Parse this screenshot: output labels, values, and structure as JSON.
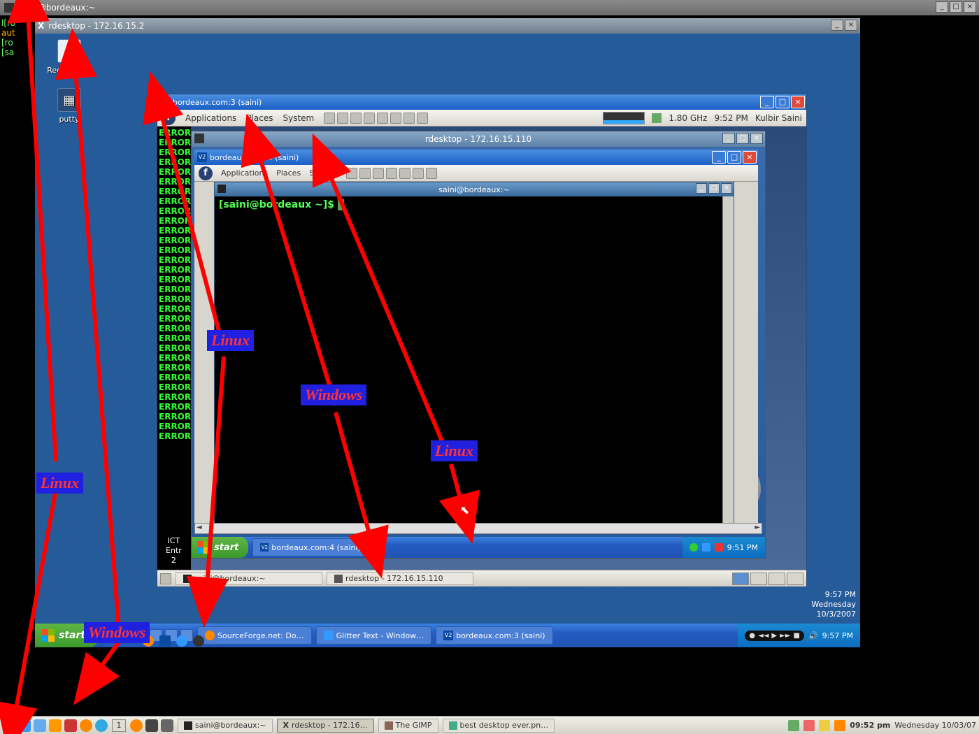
{
  "host": {
    "title": "saini@bordeaux:~",
    "side_lines": [
      "l[ro",
      "aut",
      "[ro",
      "[sa"
    ],
    "taskbar": {
      "workspace": "1",
      "tasks": [
        "saini@bordeaux:~",
        "rdesktop - 172.16…",
        "The GIMP",
        "best desktop ever.pn…"
      ],
      "clock": "09:52 pm",
      "date": "Wednesday 10/03/07"
    }
  },
  "win1": {
    "title": "rdesktop - 172.16.15.2",
    "icons": {
      "recycle": "Recycle Bin",
      "putty": "putty"
    },
    "taskbar": {
      "start": "start",
      "tasks": [
        "SourceForge.net: Do…",
        "Glitter Text - Window…",
        "bordeaux.com:3 (saini)"
      ],
      "tray_time": "9:57 PM"
    },
    "clockarea": {
      "time": "9:57 PM",
      "day": "Wednesday",
      "date": "10/3/2007"
    }
  },
  "vnc1": {
    "title": "bordeaux.com:3 (saini)",
    "panel": {
      "apps": "Applications",
      "places": "Places",
      "system": "System",
      "cpu": "1.80 GHz",
      "clock": "9:52 PM",
      "user": "Kulbir Saini"
    },
    "errors_repeat": "ERROR",
    "ict": "ICT\nEntr\n2",
    "bottom_tasks": [
      "saini@bordeaux:~",
      "rdesktop - 172.16.15.110"
    ]
  },
  "rd2": {
    "title": "rdesktop - 172.16.15.110"
  },
  "win2": {
    "taskbar": {
      "start": "start",
      "task": "bordeaux.com:4 (saini)",
      "tray_time": "9:51 PM"
    }
  },
  "vnc2": {
    "title": "bordeaux.com:4 (saini)",
    "panel": {
      "apps": "Applications",
      "places": "Places",
      "system": "System"
    }
  },
  "term2": {
    "title": "saini@bordeaux:~",
    "prompt": "[saini@bordeaux ~]$ "
  },
  "annotations": {
    "linux1": "Linux",
    "windows1": "Windows",
    "linux2": "Linux",
    "windows2": "Windows",
    "linux3": "Linux"
  }
}
